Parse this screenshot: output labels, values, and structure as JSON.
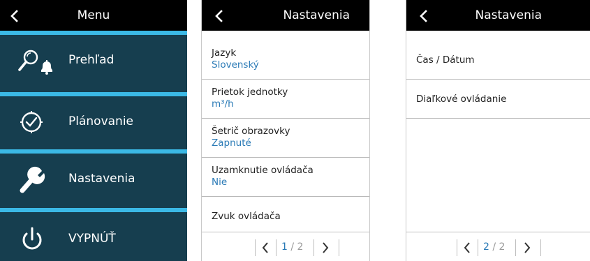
{
  "menu": {
    "title": "Menu",
    "items": [
      {
        "label": "Prehľad",
        "icon": "overview-alarm-icon"
      },
      {
        "label": "Plánovanie",
        "icon": "schedule-clock-icon"
      },
      {
        "label": "Nastavenia",
        "icon": "wrench-icon"
      },
      {
        "label": "VYPNÚŤ",
        "icon": "power-icon"
      }
    ]
  },
  "settings_page1": {
    "title": "Nastavenia",
    "rows": [
      {
        "title": "Jazyk",
        "value": "Slovenský"
      },
      {
        "title": "Prietok jednotky",
        "value": "m³/h"
      },
      {
        "title": "Šetrič obrazovky",
        "value": "Zapnuté"
      },
      {
        "title": "Uzamknutie ovládača",
        "value": "Nie"
      },
      {
        "title": "Zvuk ovládača"
      }
    ],
    "pager": {
      "current": "1",
      "separator": "/",
      "total": "2"
    }
  },
  "settings_page2": {
    "title": "Nastavenia",
    "rows": [
      {
        "title": "Čas / Dátum"
      },
      {
        "title": "Diaľkové ovládanie"
      }
    ],
    "pager": {
      "current": "2",
      "separator": "/",
      "total": "2"
    }
  },
  "colors": {
    "menu_bg": "#163e4f",
    "separator": "#3bb9e6",
    "header_bg": "#000000",
    "value_text": "#2a7ab6"
  }
}
